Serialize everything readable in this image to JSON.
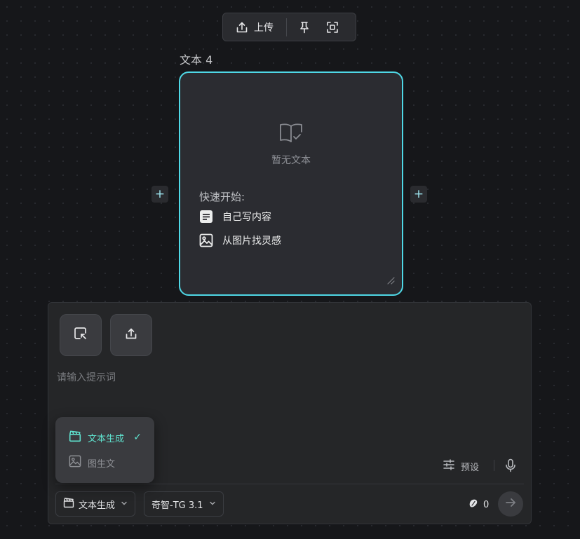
{
  "toolbar": {
    "upload_label": "上传",
    "upload_icon": "upload-icon",
    "pin_icon": "pin-icon",
    "fit_icon": "fit-screen-icon"
  },
  "node": {
    "title": "文本 4",
    "empty_text": "暂无文本",
    "quick_start_label": "快速开始:",
    "quick_items": [
      {
        "label": "自己写内容",
        "icon": "document-icon"
      },
      {
        "label": "从图片找灵感",
        "icon": "image-icon"
      }
    ]
  },
  "add_left": "+",
  "add_right": "+",
  "prompt": {
    "placeholder": "请输入提示词",
    "preset_label": "预设"
  },
  "bottom_bar": {
    "mode_label": "文本生成",
    "model_label": "奇智-TG 3.1",
    "credits": "0"
  },
  "mode_menu": {
    "items": [
      {
        "label": "文本生成",
        "selected": true
      },
      {
        "label": "图生文",
        "selected": false
      }
    ],
    "check": "✓"
  },
  "colors": {
    "accent_cyan": "#4fd8e6",
    "accent_mint": "#5fe3cf",
    "background": "#16171a",
    "card": "#2b2c31"
  }
}
